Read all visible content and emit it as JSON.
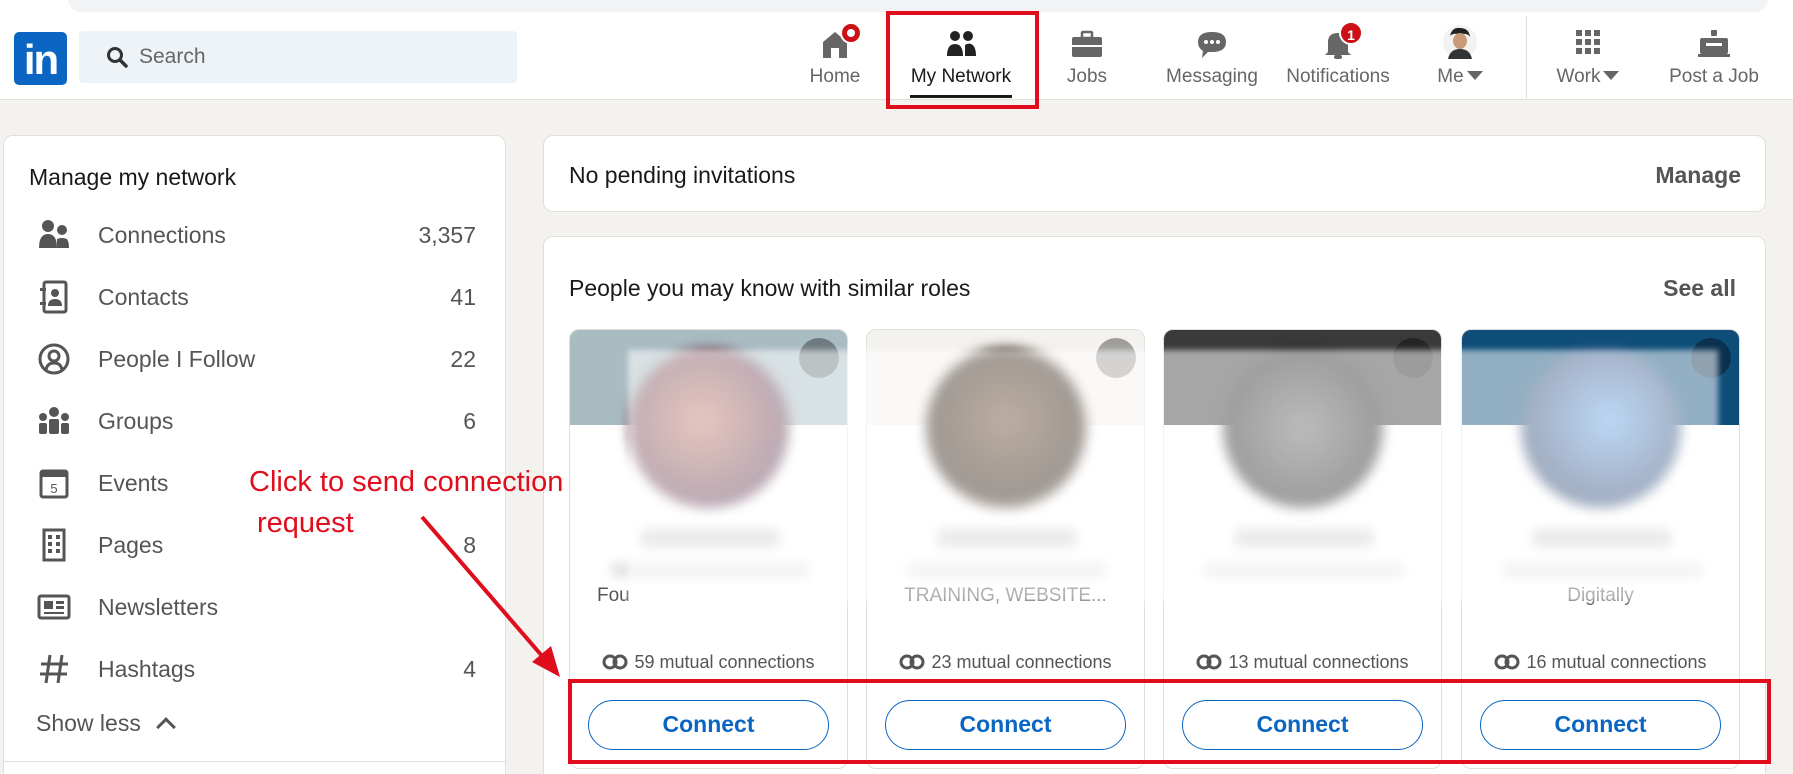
{
  "search": {
    "placeholder": "Search"
  },
  "nav": {
    "home": "Home",
    "my_network": "My Network",
    "jobs": "Jobs",
    "messaging": "Messaging",
    "notifications": "Notifications",
    "notifications_badge": "1",
    "me": "Me",
    "work": "Work",
    "post_job": "Post a Job"
  },
  "sidebar": {
    "title": "Manage my network",
    "items": [
      {
        "label": "Connections",
        "count": "3,357",
        "icon": "connections-icon"
      },
      {
        "label": "Contacts",
        "count": "41",
        "icon": "contacts-icon"
      },
      {
        "label": "People I Follow",
        "count": "22",
        "icon": "follow-icon"
      },
      {
        "label": "Groups",
        "count": "6",
        "icon": "groups-icon"
      },
      {
        "label": "Events",
        "count": "",
        "icon": "events-icon"
      },
      {
        "label": "Pages",
        "count": "8",
        "icon": "pages-icon"
      },
      {
        "label": "Newsletters",
        "count": "",
        "icon": "newsletters-icon"
      },
      {
        "label": "Hashtags",
        "count": "4",
        "icon": "hashtag-icon"
      }
    ],
    "show_less": "Show less"
  },
  "invitations": {
    "text": "No pending invitations",
    "manage": "Manage"
  },
  "pymk": {
    "title": "People you may know with similar roles",
    "see_all": "See all",
    "cards": [
      {
        "occupation": "Fou",
        "mutual": "59 mutual connections",
        "connect": "Connect"
      },
      {
        "occupation": "TRAINING, WEBSITE...",
        "mutual": "23 mutual connections",
        "connect": "Connect"
      },
      {
        "occupation": "",
        "mutual": "13 mutual connections",
        "connect": "Connect"
      },
      {
        "occupation": "Digitally",
        "mutual": "16 mutual connections",
        "connect": "Connect"
      }
    ]
  },
  "annotation": {
    "line1": "Click to send connection",
    "line2": "request"
  },
  "colors": {
    "brand": "#0a66c2",
    "highlight": "#e00d1d",
    "badge": "#cc1016"
  }
}
